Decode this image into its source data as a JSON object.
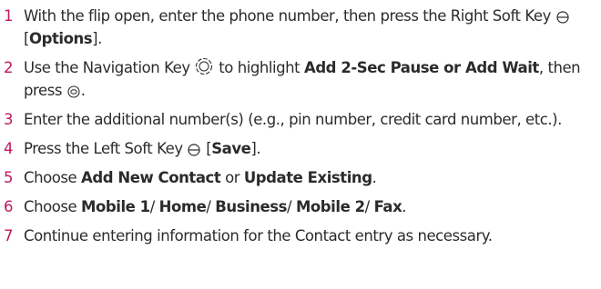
{
  "steps": [
    {
      "number": "1",
      "t1": "With the flip open, enter the phone number, then press the Right Soft Key ",
      "icon": "soft-key-icon",
      "t2": " [",
      "b1": "Options",
      "t3": "]."
    },
    {
      "number": "2",
      "t1": "Use the Navigation Key ",
      "icon": "navigation-key-icon",
      "t2": " to highlight ",
      "b1": "Add 2-Sec Pause or Add Wait",
      "t3": ", then press ",
      "icon2": "ok-key-icon",
      "t4": "."
    },
    {
      "number": "3",
      "t1": "Enter the additional number(s) (e.g., pin number, credit card number, etc.)."
    },
    {
      "number": "4",
      "t1": "Press the Left Soft Key ",
      "icon": "soft-key-icon",
      "t2": " [",
      "b1": "Save",
      "t3": "]."
    },
    {
      "number": "5",
      "t1": "Choose ",
      "b1": "Add New Contact",
      "t2": " or ",
      "b2": "Update Existing",
      "t3": "."
    },
    {
      "number": "6",
      "t1": "Choose ",
      "b1": "Mobile 1",
      "t2": "/ ",
      "b2": "Home",
      "t3": "/ ",
      "b3": "Business",
      "t4": "/ ",
      "b4": "Mobile 2",
      "t5": "/ ",
      "b5": "Fax",
      "t6": "."
    },
    {
      "number": "7",
      "t1": "Continue entering information for the Contact entry as necessary."
    }
  ],
  "colors": {
    "step_number": "#c0185e",
    "text": "#2b2b2b"
  }
}
